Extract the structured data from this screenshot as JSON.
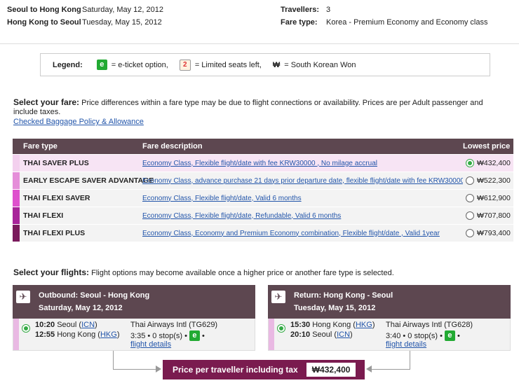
{
  "summary": {
    "route1": "Seoul to Hong Kong",
    "date1": "Saturday, May 12, 2012",
    "route2": "Hong Kong to Seoul",
    "date2": "Tuesday, May 15, 2012",
    "travellers_label": "Travellers:",
    "travellers_value": "3",
    "fare_type_label": "Fare type:",
    "fare_type_value": "Korea - Premium Economy and Economy class"
  },
  "legend": {
    "title": "Legend:",
    "eticket_glyph": "e",
    "eticket_text": "= e-ticket option,",
    "limited_glyph": "2",
    "limited_text": "= Limited seats left,",
    "won_glyph": "₩",
    "won_text": "= South Korean Won"
  },
  "select_fare": {
    "heading": "Select your fare:",
    "text": "Price differences within a fare type may be due to flight connections or availability. Prices are per Adult passenger and include taxes.",
    "baggage_link": "Checked Baggage Policy & Allowance"
  },
  "fare_table": {
    "headers": [
      "Fare type",
      "Fare description",
      "Lowest price"
    ],
    "rows": [
      {
        "type": "THAI SAVER PLUS",
        "desc": "Economy Class, Flexible flight/date with fee KRW30000 , No milage accrual",
        "price": "₩432,400",
        "color": "#f3d0ee",
        "selected": true
      },
      {
        "type": "EARLY ESCAPE SAVER ADVANTAGE",
        "desc": "Economy Class, advance purchase 21 days prior departure date, flexible flight/date with fee KRW30000,",
        "price": "₩522,300",
        "color": "#e58ed9",
        "selected": false
      },
      {
        "type": "THAI FLEXI SAVER",
        "desc": "Economy Class, Flexible flight/date, Valid 6 months",
        "price": "₩612,900",
        "color": "#de51cd",
        "selected": false
      },
      {
        "type": "THAI FLEXI",
        "desc": "Economy Class, Flexible flight/date, Refundable, Valid 6 months",
        "price": "₩707,800",
        "color": "#a8249a",
        "selected": false
      },
      {
        "type": "THAI FLEXI PLUS",
        "desc": "Economy Class, Economy and Premium Economy combination, Flexible flight/date , Valid 1year",
        "price": "₩793,400",
        "color": "#7a1a5c",
        "selected": false
      }
    ]
  },
  "select_flights": {
    "heading": "Select your flights:",
    "text": "Flight options may become available once a higher price or another fare type is selected."
  },
  "outbound": {
    "title": "Outbound: Seoul - Hong Kong",
    "date": "Saturday, May 12, 2012",
    "dep_time": "10:20",
    "dep_city": "Seoul",
    "dep_code": "ICN",
    "arr_time": "12:55",
    "arr_city": "Hong Kong",
    "arr_code": "HKG",
    "airline": "Thai Airways Intl (TG629)",
    "duration": "3:35",
    "stops": "0 stop(s)",
    "details_link": "flight details"
  },
  "return": {
    "title": "Return: Hong Kong - Seoul",
    "date": "Tuesday, May 15, 2012",
    "dep_time": "15:30",
    "dep_city": "Hong Kong",
    "dep_code": "HKG",
    "arr_time": "20:10",
    "arr_city": "Seoul",
    "arr_code": "ICN",
    "airline": "Thai Airways Intl (TG628)",
    "duration": "3:40",
    "stops": "0 stop(s)",
    "details_link": "flight details"
  },
  "price": {
    "label": "Price per traveller including tax",
    "value": "₩432,400"
  },
  "colors": {
    "header_bg": "#5d4750",
    "price_bg": "#7a1b4f",
    "eticket": "#22aa33"
  }
}
